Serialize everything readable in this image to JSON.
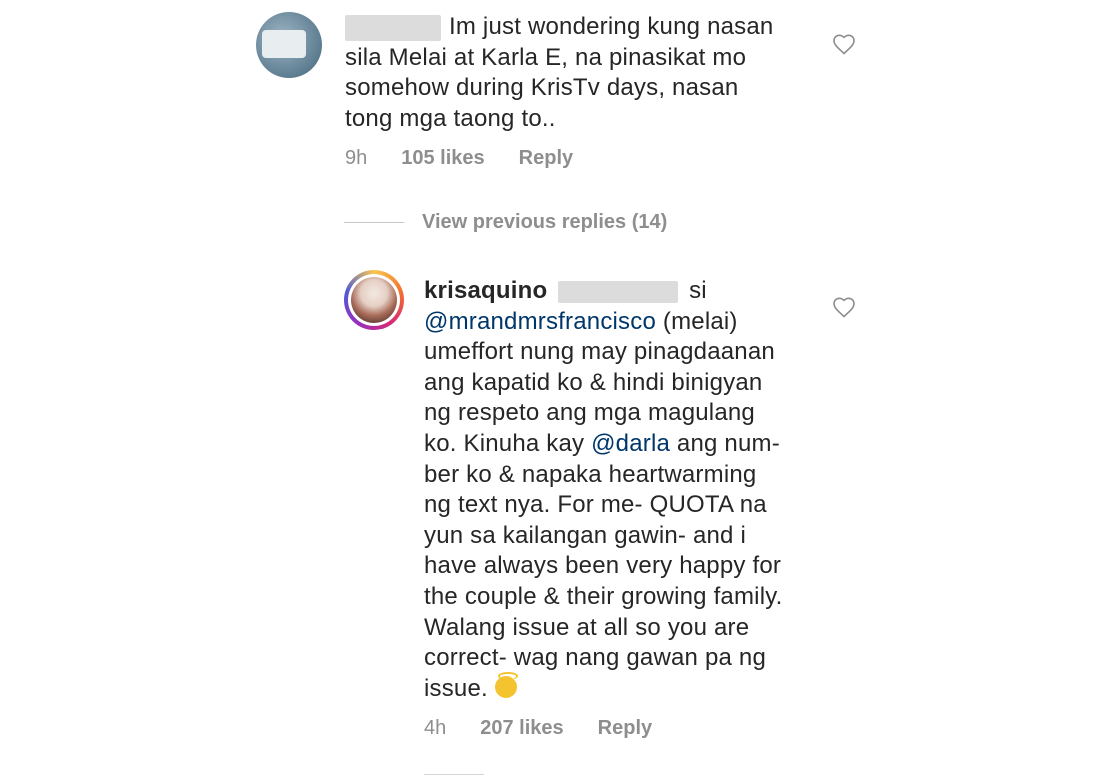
{
  "comment1": {
    "lines": [
      "Im just wondering kung nasan",
      "sila Melai at Karla E, na pinasikat mo",
      "somehow during KrisTv days, nasan",
      "tong mga taong to.."
    ],
    "time": "9h",
    "likes": "105 likes",
    "reply": "Reply"
  },
  "view_previous_replies": "View previous replies (14)",
  "comment2": {
    "username": "krisaquino",
    "after_redact": "si",
    "mention1": "@mrandmrsfrancisco",
    "line2_rest": " (melai)",
    "lines": [
      "umeffort nung may pinagdaanan",
      "ang kapatid ko & hindi binigyan",
      "ng respeto ang mga magulang"
    ],
    "line6_pre": "ko. Kinuha kay ",
    "mention2": "@darla",
    "line6_post": " ang num-",
    "lines_b": [
      "ber ko & napaka heartwarming",
      "ng text nya. For me- QUOTA na",
      "yun sa kailangan gawin- and i",
      "have always been very happy for",
      "the couple & their growing family.",
      "Walang issue at all so you are",
      "correct- wag nang gawan pa ng"
    ],
    "last_line": "issue. ",
    "emoji": "angel-emoji",
    "time": "4h",
    "likes": "207 likes",
    "reply": "Reply"
  }
}
